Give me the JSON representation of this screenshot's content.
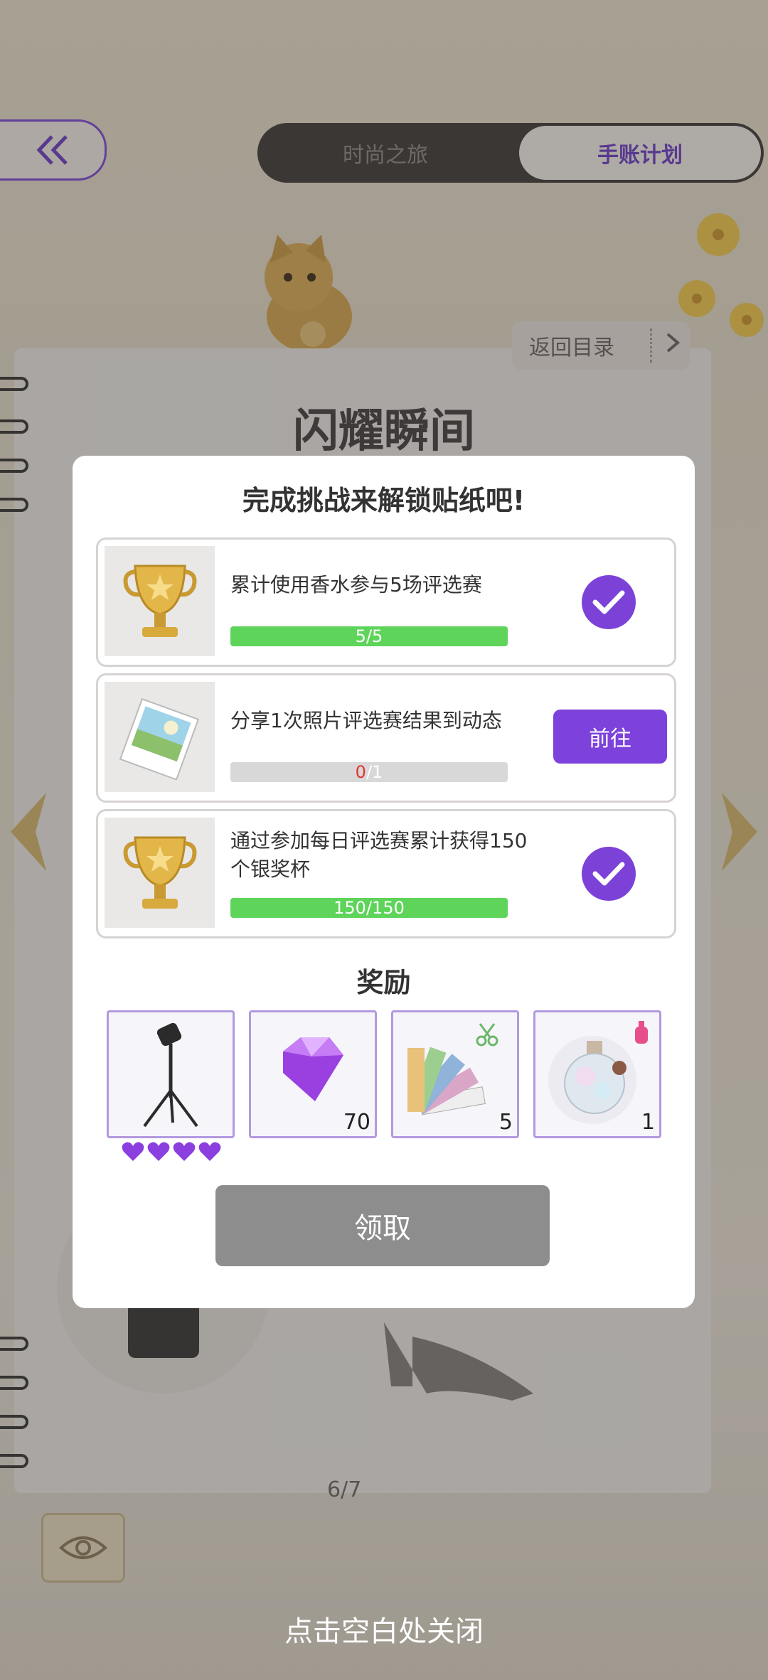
{
  "header": {
    "back_icon": "double-chevron-left-icon",
    "tabs": [
      {
        "label": "时尚之旅",
        "active": false
      },
      {
        "label": "手账计划",
        "active": true
      }
    ]
  },
  "notebook": {
    "title": "闪耀瞬间",
    "return_label": "返回目录",
    "page_indicator": "6/7"
  },
  "modal": {
    "title": "完成挑战来解锁贴纸吧!",
    "tasks": [
      {
        "text": "累计使用香水参与5场评选赛",
        "icon": "trophy-icon",
        "current": "5",
        "total": "5",
        "progress": 1.0,
        "status": "completed"
      },
      {
        "text": "分享1次照片评选赛结果到动态",
        "icon": "photo-icon",
        "current": "0",
        "total": "1",
        "progress": 0.0,
        "status": "incomplete",
        "action_label": "前往"
      },
      {
        "text": "通过参加每日评选赛累计获得150个银奖杯",
        "icon": "trophy-icon",
        "current": "150",
        "total": "150",
        "progress": 1.0,
        "status": "completed"
      }
    ],
    "rewards_title": "奖励",
    "rewards": [
      {
        "icon": "spotlight-stand-icon",
        "count": "",
        "hearts": 4
      },
      {
        "icon": "purple-gem-icon",
        "count": "70"
      },
      {
        "icon": "color-swatch-icon",
        "count": "5"
      },
      {
        "icon": "perfume-bottle-icon",
        "count": "1"
      }
    ],
    "claim_label": "领取"
  },
  "footer": {
    "close_hint": "点击空白处关闭"
  },
  "colors": {
    "accent_purple": "#7d42db",
    "progress_green": "#5ed45a",
    "claim_disabled": "#8e8d8d",
    "progress_zero_red": "#e0342f"
  }
}
